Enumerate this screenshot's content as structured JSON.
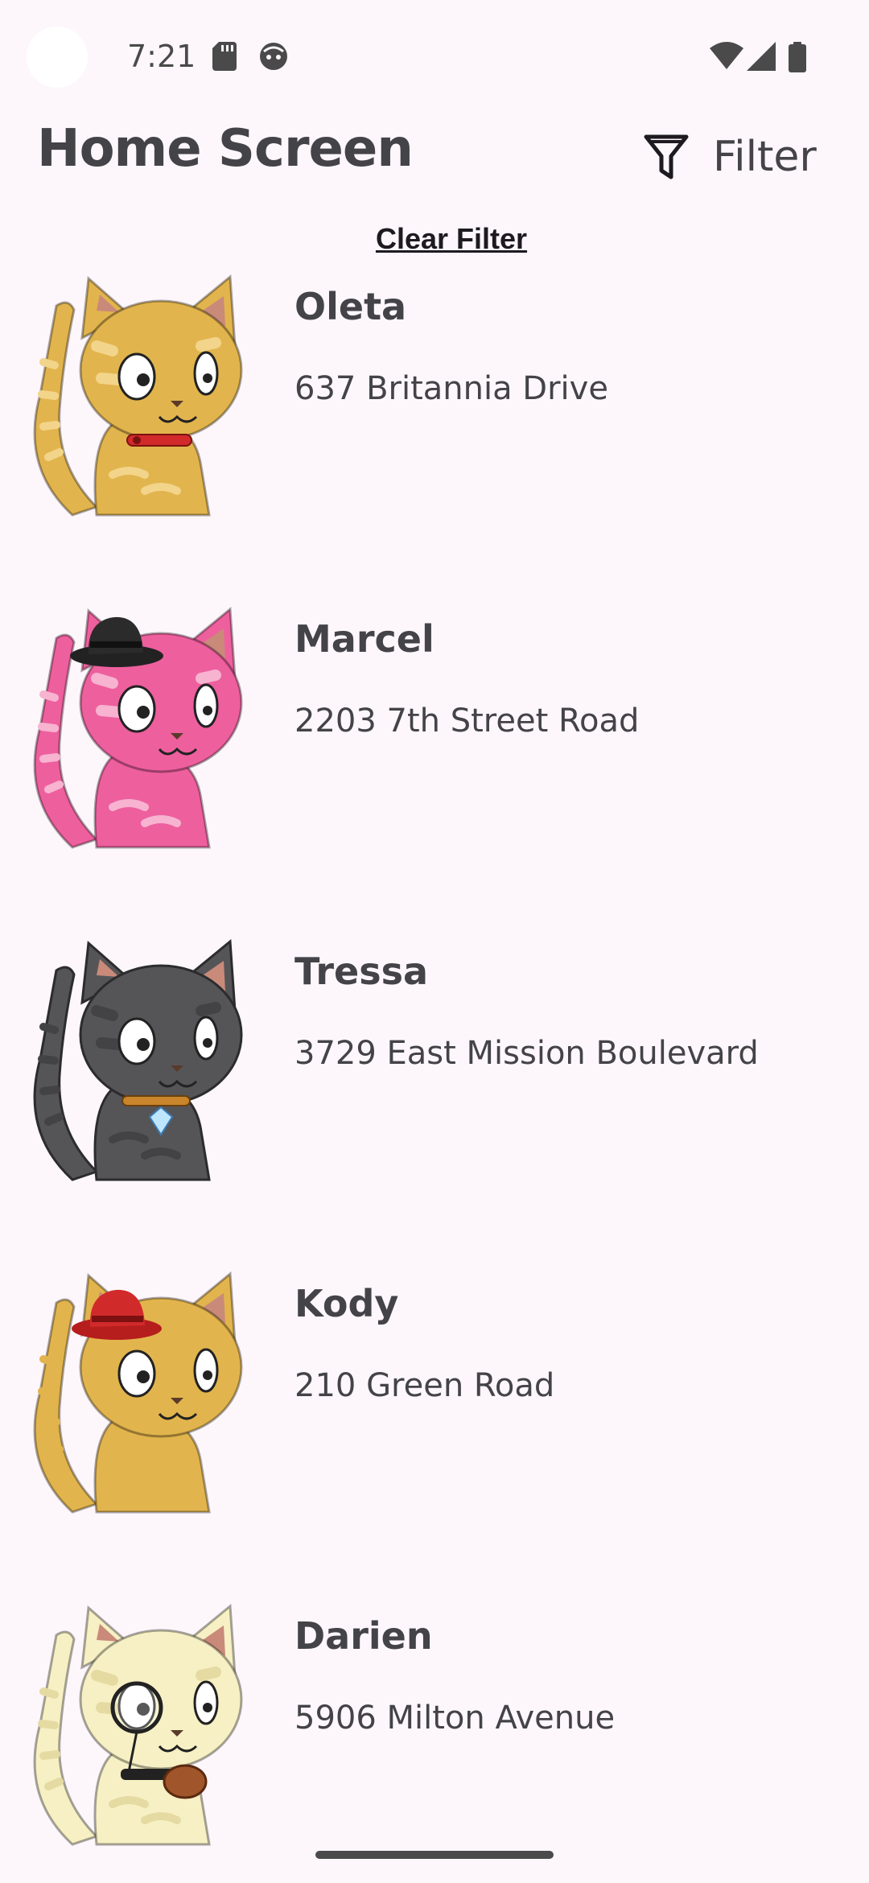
{
  "status_bar": {
    "time": "7:21",
    "icons": [
      "sd-card-icon",
      "android-face-icon",
      "wifi-icon",
      "signal-icon",
      "battery-icon"
    ]
  },
  "header": {
    "title": "Home Screen",
    "filter_label": "Filter",
    "filter_icon": "funnel-icon"
  },
  "clear_filter_label": "Clear Filter",
  "cats": [
    {
      "name": "Oleta",
      "address": "637 Britannia Drive",
      "fur": "#E2B44D",
      "spots": "#F2D48A",
      "accessory": "red-collar"
    },
    {
      "name": "Marcel",
      "address": "2203 7th Street Road",
      "fur": "#EE5F9E",
      "spots": "#F7B3D0",
      "accessory": "black-hat"
    },
    {
      "name": "Tressa",
      "address": "3729 East Mission Boulevard",
      "fur": "#555558",
      "spots": "#434345",
      "accessory": "diamond-collar"
    },
    {
      "name": "Kody",
      "address": "210 Green Road",
      "fur": "#E2B44D",
      "spots": "#E2B44D",
      "accessory": "red-hat"
    },
    {
      "name": "Darien",
      "address": "5906 Milton Avenue",
      "fur": "#F6F0C4",
      "spots": "#E5DBA2",
      "accessory": "monocle"
    }
  ],
  "colors": {
    "background": "#FDF7FB",
    "text": "#444347"
  }
}
